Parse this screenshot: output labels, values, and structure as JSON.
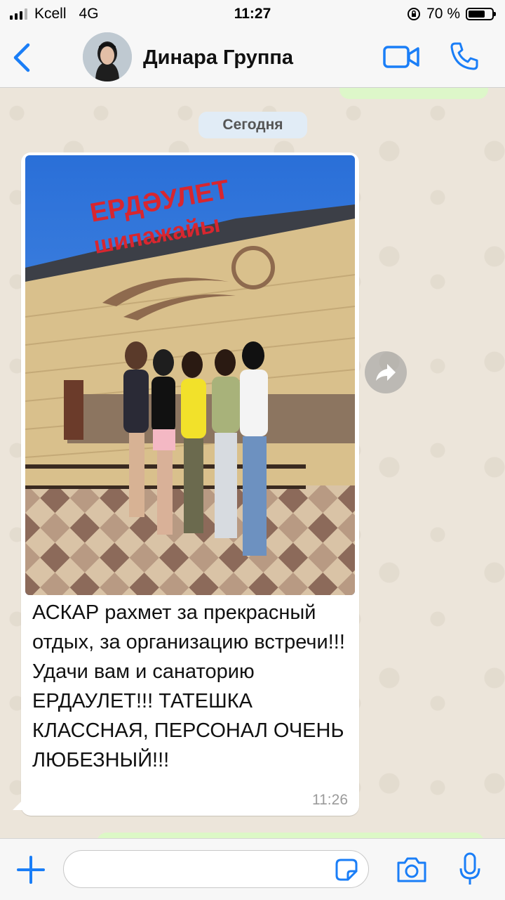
{
  "status_bar": {
    "carrier": "Kcell",
    "network": "4G",
    "time": "11:27",
    "battery_percent": "70 %",
    "battery_level": 0.7
  },
  "header": {
    "contact_name": "Динара Группа",
    "icons": [
      "back-chevron-icon",
      "video-call-icon",
      "phone-call-icon"
    ]
  },
  "chat": {
    "date_label": "Сегодня",
    "message": {
      "photo_signage_line1": "ЕРДӘУЛЕТ",
      "photo_signage_line2": "шипажайы",
      "text": "АСКАР рахмет за прекрасный отдых, за организацию встречи!!! Удачи вам и санаторию ЕРДАУЛЕТ!!! ТАТЕШКА КЛАССНАЯ, ПЕРСОНАЛ ОЧЕНЬ ЛЮБЕЗНЫЙ!!!",
      "time": "11:26"
    }
  },
  "input_bar": {
    "placeholder": "",
    "icons": [
      "plus-icon",
      "sticker-icon",
      "camera-icon",
      "microphone-icon"
    ]
  },
  "colors": {
    "accent": "#1a7ef7",
    "outgoing_bubble": "#dcf8c6",
    "incoming_bubble": "#ffffff",
    "date_pill": "#e1ecf6"
  }
}
